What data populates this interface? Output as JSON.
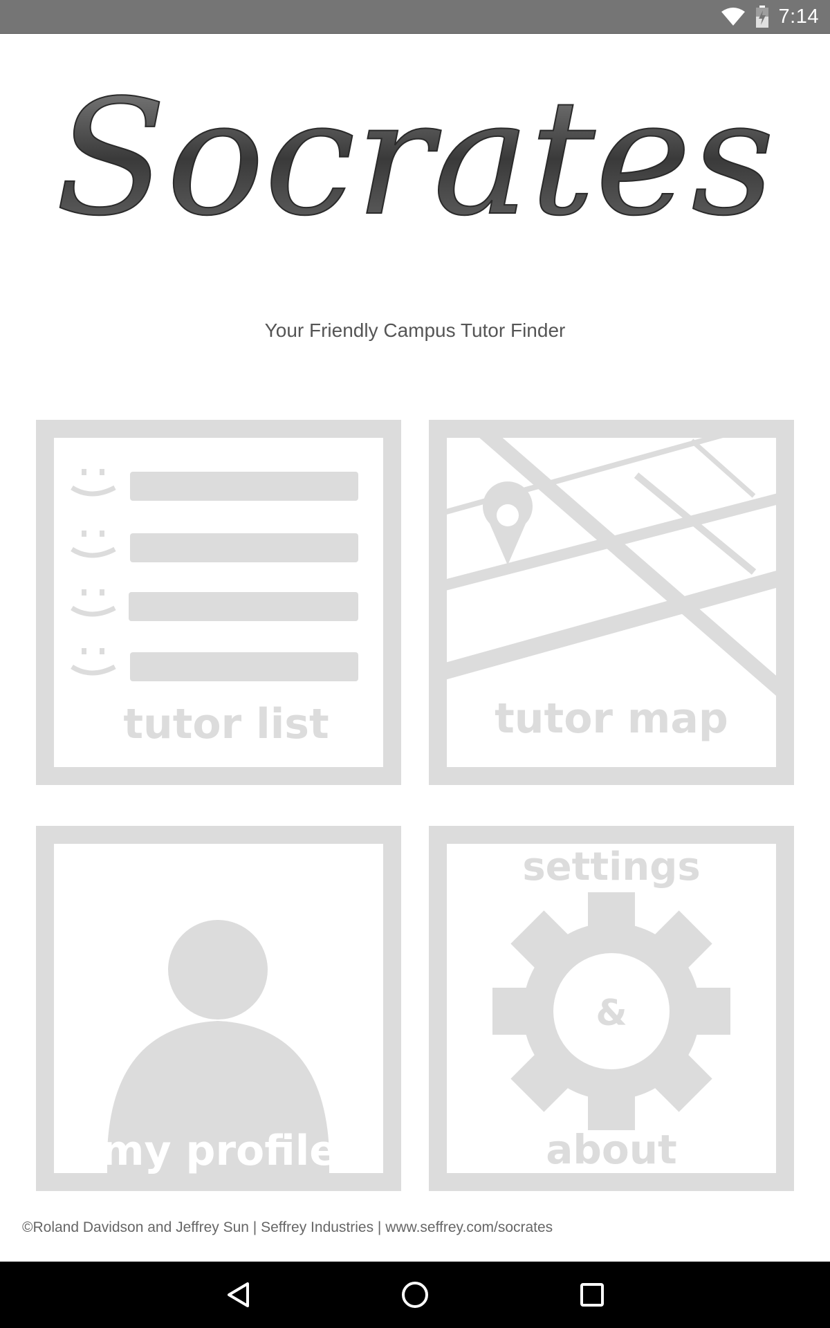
{
  "status_bar": {
    "time": "7:14",
    "icons": [
      "wifi-icon",
      "battery-charging-icon"
    ]
  },
  "app": {
    "logo_text": "Socrates",
    "tagline": "Your Friendly Campus Tutor Finder"
  },
  "tiles": {
    "tutor_list": {
      "label": "tutor list",
      "icon": "list-icon"
    },
    "tutor_map": {
      "label": "tutor map",
      "icon": "map-icon"
    },
    "my_profile": {
      "label": "my profile",
      "icon": "person-icon"
    },
    "settings": {
      "label_top": "settings",
      "center": "&",
      "label_bottom": "about",
      "icon": "gear-icon"
    }
  },
  "footer": {
    "text": "©Roland Davidson and Jeffrey Sun | Seffrey Industries | www.seffrey.com/socrates"
  },
  "nav_bar": {
    "buttons": [
      "back-icon",
      "home-icon",
      "recents-icon"
    ]
  },
  "colors": {
    "status_bar": "#757575",
    "tile_gray": "#dcdcdc",
    "text_gray": "#555555",
    "nav_bar": "#000000"
  }
}
